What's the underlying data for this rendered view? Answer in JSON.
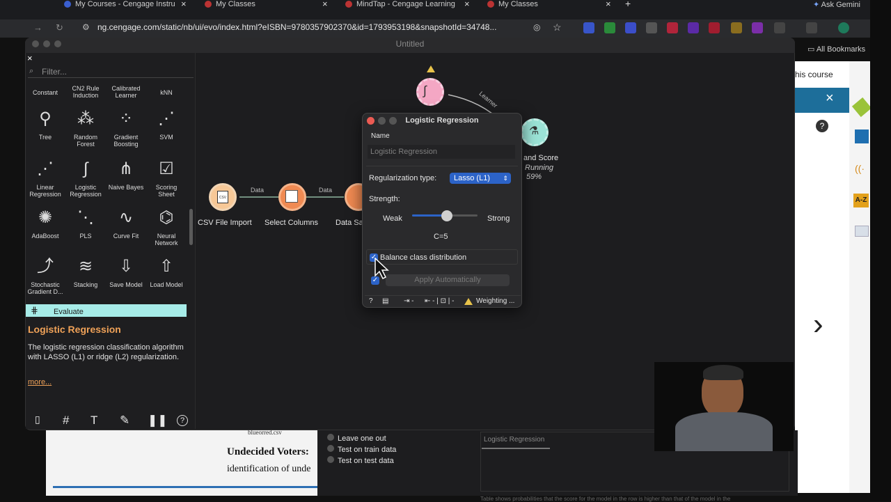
{
  "browser": {
    "tabs": [
      {
        "label": "My Courses - Cengage Instru"
      },
      {
        "label": "My Classes"
      },
      {
        "label": "MindTap - Cengage Learning"
      },
      {
        "label": "My Classes"
      }
    ],
    "new_tab": "+",
    "gemini": "Ask Gemini",
    "url": "ng.cengage.com/static/nb/ui/evo/index.html?eISBN=9780357902370&id=1793953198&snapshotId=34748...",
    "bookmarks_label": "All Bookmarks"
  },
  "orange": {
    "window_title": "Untitled",
    "filter_placeholder": "Filter...",
    "widgets": [
      {
        "label": "Constant",
        "icon": "constant-icon"
      },
      {
        "label": "CN2 Rule Induction",
        "icon": "cn2-icon"
      },
      {
        "label": "Calibrated Learner",
        "icon": "calibrated-icon"
      },
      {
        "label": "kNN",
        "icon": "knn-icon"
      },
      {
        "label": "Tree",
        "icon": "tree-icon"
      },
      {
        "label": "Random Forest",
        "icon": "random-forest-icon"
      },
      {
        "label": "Gradient Boosting",
        "icon": "gradient-boosting-icon"
      },
      {
        "label": "SVM",
        "icon": "svm-icon"
      },
      {
        "label": "Linear Regression",
        "icon": "linear-regression-icon"
      },
      {
        "label": "Logistic Regression",
        "icon": "logistic-regression-icon"
      },
      {
        "label": "Naive Bayes",
        "icon": "naive-bayes-icon"
      },
      {
        "label": "Scoring Sheet",
        "icon": "scoring-sheet-icon"
      },
      {
        "label": "AdaBoost",
        "icon": "adaboost-icon"
      },
      {
        "label": "PLS",
        "icon": "pls-icon"
      },
      {
        "label": "Curve Fit",
        "icon": "curve-fit-icon"
      },
      {
        "label": "Neural Network",
        "icon": "neural-network-icon"
      },
      {
        "label": "Stochastic Gradient D...",
        "icon": "sgd-icon"
      },
      {
        "label": "Stacking",
        "icon": "stacking-icon"
      },
      {
        "label": "Save Model",
        "icon": "save-model-icon"
      },
      {
        "label": "Load Model",
        "icon": "load-model-icon"
      }
    ],
    "category_evaluate": "Evaluate",
    "description": {
      "title": "Logistic Regression",
      "text": "The logistic regression classification algorithm with LASSO (L1) or ridge (L2) regularization.",
      "more": "more..."
    },
    "canvas": {
      "nodes": {
        "csv": "CSV File Import",
        "select": "Select Columns",
        "datasampler": "Data Sa",
        "test_score": "and Score",
        "running": "Running",
        "running_pct": "59%"
      },
      "links": {
        "data1": "Data",
        "data2": "Data",
        "learner": "Learner"
      }
    }
  },
  "dialog": {
    "title": "Logistic Regression",
    "name_label": "Name",
    "name_value": "Logistic Regression",
    "reg_label": "Regularization type:",
    "reg_value": "Lasso (L1)",
    "strength_label": "Strength:",
    "weak": "Weak",
    "strong": "Strong",
    "c_value": "C=5",
    "strength_fraction": 0.53,
    "balance_label": "Balance class distribution",
    "balance_checked": true,
    "apply_label": "Apply Automatically",
    "status_warning": "Weighting ..."
  },
  "right_pane": {
    "course_text": "his course",
    "close": "×",
    "next": "›"
  },
  "bottom": {
    "book_caption": "blueorred.csv",
    "book_heading": "Undecided Voters:",
    "book_line": "identification of unde",
    "options": [
      "Leave one out",
      "Test on train data",
      "Test on test data"
    ],
    "table_tab": "Logistic Regression",
    "footer_text": "Table shows probabilities that the score for the model in the row is higher than that of the model in the"
  }
}
